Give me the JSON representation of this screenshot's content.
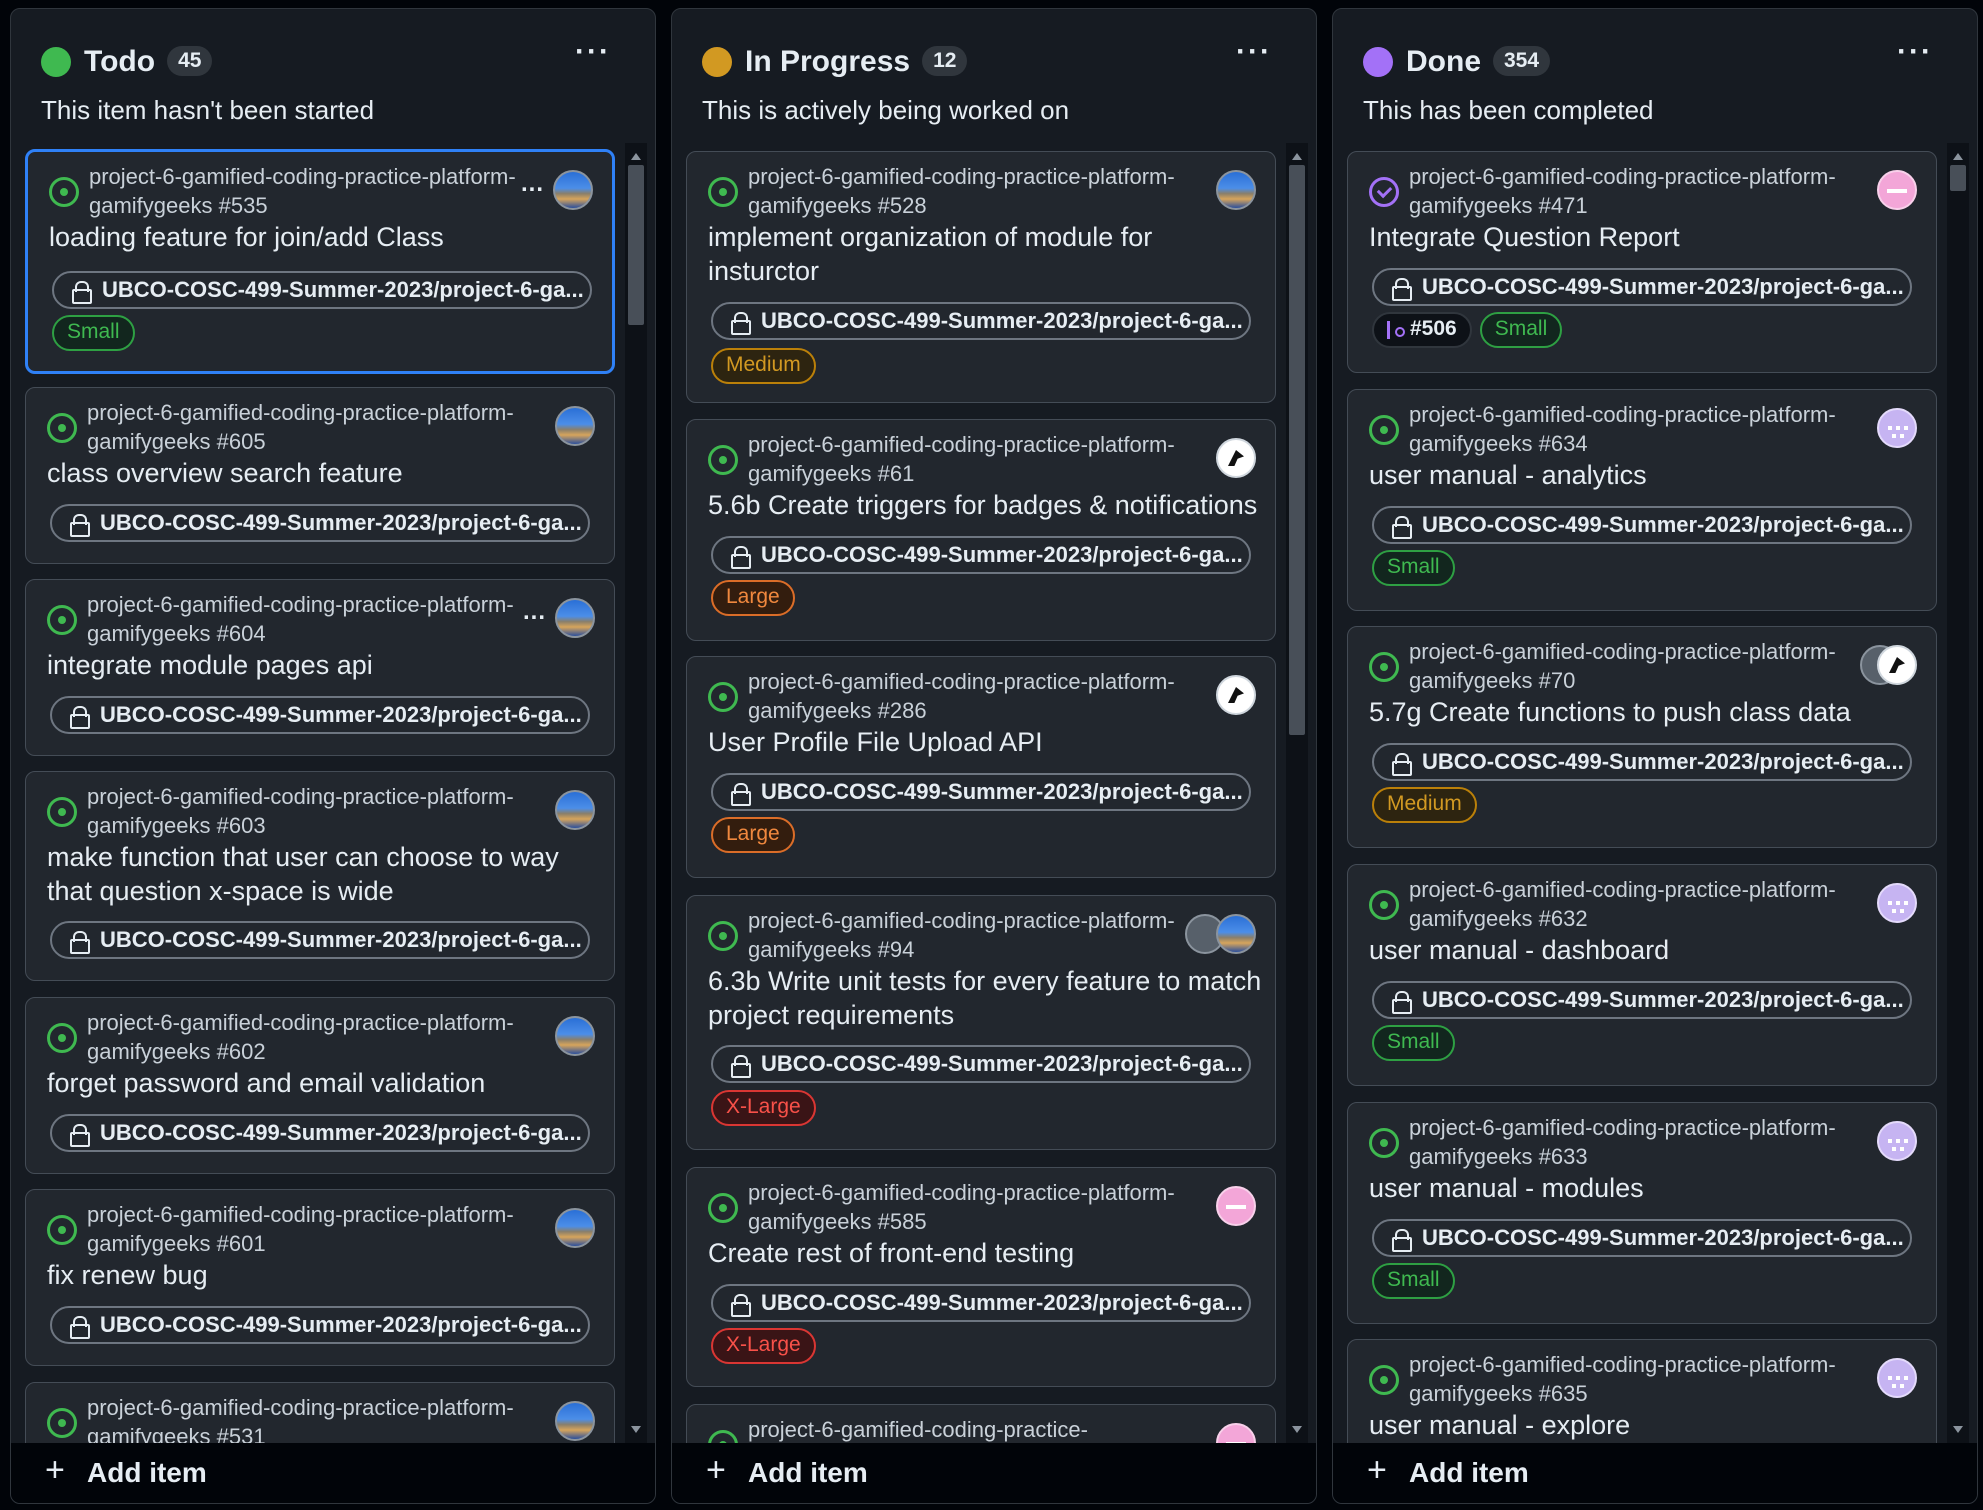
{
  "repo_label": "UBCO-COSC-499-Summer-2023/project-6-ga...",
  "add_item_label": "Add item",
  "columns": [
    {
      "title": "Todo",
      "count": "45",
      "color": "#3fb950",
      "description": "This item hasn't been started",
      "cards": [
        {
          "ref": "project-6-gamified-coding-practice-platform-gamifygeeks #535",
          "title": "loading feature for join/add Class",
          "size": "Small",
          "avatar": "globe",
          "menu": "..."
        },
        {
          "ref": "project-6-gamified-coding-practice-platform-gamifygeeks #605",
          "title": "class overview search feature",
          "size": "",
          "avatar": "globe"
        },
        {
          "ref": "project-6-gamified-coding-practice-platform-gamifygeeks #604",
          "title": "integrate module pages api",
          "size": "",
          "avatar": "globe",
          "menu": "..."
        },
        {
          "ref": "project-6-gamified-coding-practice-platform-gamifygeeks #603",
          "title": "make function that user can choose to way that question x-space is wide",
          "size": "",
          "avatar": "globe"
        },
        {
          "ref": "project-6-gamified-coding-practice-platform-gamifygeeks #602",
          "title": "forget password and email validation",
          "size": "",
          "avatar": "globe"
        },
        {
          "ref": "project-6-gamified-coding-practice-platform-gamifygeeks #601",
          "title": "fix renew bug",
          "size": "",
          "avatar": "globe"
        },
        {
          "ref": "project-6-gamified-coding-practice-platform-gamifygeeks #531",
          "title": "",
          "size": "",
          "avatar": "globe"
        }
      ]
    },
    {
      "title": "In Progress",
      "count": "12",
      "color": "#d29922",
      "description": "This is actively being worked on",
      "cards": [
        {
          "ref": "project-6-gamified-coding-practice-platform-gamifygeeks #528",
          "title": "implement organization of module for insturctor",
          "size": "Medium",
          "avatar": "globe"
        },
        {
          "ref": "project-6-gamified-coding-practice-platform-gamifygeeks #61",
          "title": "5.6b Create triggers for badges & notifications",
          "size": "Large",
          "avatar": "ghost"
        },
        {
          "ref": "project-6-gamified-coding-practice-platform-gamifygeeks #286",
          "title": "User Profile File Upload API",
          "size": "Large",
          "avatar": "ghost"
        },
        {
          "ref": "project-6-gamified-coding-practice-platform-gamifygeeks #94",
          "title": "6.3b Write unit tests for every feature to match project requirements",
          "size": "X-Large",
          "avatar": "globe"
        },
        {
          "ref": "project-6-gamified-coding-practice-platform-gamifygeeks #585",
          "title": "Create rest of front-end testing",
          "size": "X-Large",
          "avatar": "pink"
        },
        {
          "ref": "project-6-gamified-coding-practice-",
          "title": "",
          "size": "",
          "avatar": "pink"
        }
      ]
    },
    {
      "title": "Done",
      "count": "354",
      "color": "#a371f7",
      "description": "This has been completed",
      "cards": [
        {
          "ref": "project-6-gamified-coding-practice-platform-gamifygeeks #471",
          "title": "Integrate Question Report",
          "size": "Small",
          "pr": "#506",
          "avatar": "pink"
        },
        {
          "ref": "project-6-gamified-coding-practice-platform-gamifygeeks #634",
          "title": "user manual - analytics",
          "size": "Small",
          "avatar": "lilac"
        },
        {
          "ref": "project-6-gamified-coding-practice-platform-gamifygeeks #70",
          "title": "5.7g Create functions to push class data",
          "size": "Medium",
          "avatar": "ghost"
        },
        {
          "ref": "project-6-gamified-coding-practice-platform-gamifygeeks #632",
          "title": "user manual - dashboard",
          "size": "Small",
          "avatar": "lilac"
        },
        {
          "ref": "project-6-gamified-coding-practice-platform-gamifygeeks #633",
          "title": "user manual - modules",
          "size": "Small",
          "avatar": "lilac"
        },
        {
          "ref": "project-6-gamified-coding-practice-platform-gamifygeeks #635",
          "title": "user manual - explore",
          "size": "",
          "avatar": "lilac"
        }
      ]
    }
  ]
}
